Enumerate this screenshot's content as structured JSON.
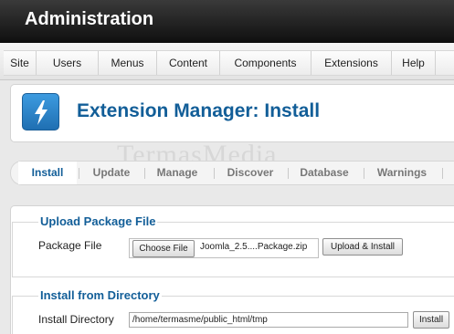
{
  "header": {
    "title": "Administration"
  },
  "menu": {
    "items": [
      "Site",
      "Users",
      "Menus",
      "Content",
      "Components",
      "Extensions",
      "Help"
    ]
  },
  "toolbar": {
    "icon": "extension-bolt-icon",
    "title": "Extension Manager: Install"
  },
  "watermark": "TermasMedia",
  "tabs": {
    "items": [
      "Install",
      "Update",
      "Manage",
      "Discover",
      "Database",
      "Warnings"
    ],
    "active": "Install"
  },
  "upload": {
    "legend": "Upload Package File",
    "label": "Package File",
    "choose_label": "Choose File",
    "file_name": "Joomla_2.5....Package.zip",
    "submit_label": "Upload & Install"
  },
  "directory": {
    "legend": "Install from Directory",
    "label": "Install Directory",
    "value": "/home/termasme/public_html/tmp",
    "submit_label": "Install"
  },
  "colors": {
    "accent": "#125e98",
    "header_bg": "#1a1a1a"
  }
}
